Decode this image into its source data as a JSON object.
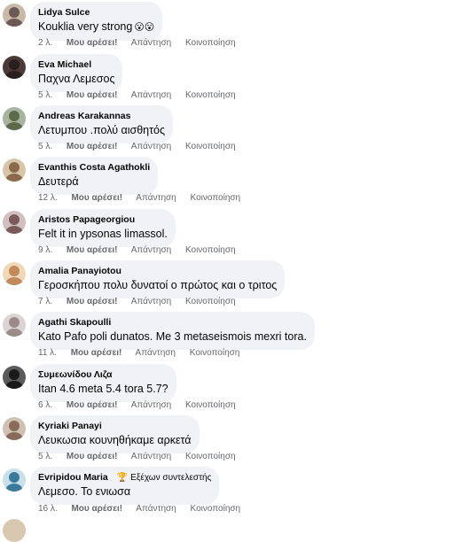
{
  "comments": [
    {
      "author": "Lidya Sulce",
      "text": "Kouklia very strong",
      "emoji": "😮😮",
      "time": "2 λ.",
      "avatar_color": "#6d5a55",
      "avatar_bg": "#c9b9a9"
    },
    {
      "author": "Eva Michael",
      "text": "Παχνα Λεμεσος",
      "emoji": "",
      "time": "5 λ.",
      "avatar_color": "#2a1f1f",
      "avatar_bg": "#4b3a38"
    },
    {
      "author": "Andreas Karakannas",
      "text": "Λετυμπου .πολύ αισθητός",
      "emoji": "",
      "time": "5 λ.",
      "avatar_color": "#5a6a4a",
      "avatar_bg": "#a8b4a0"
    },
    {
      "author": "Evanthis Costa Agathokli",
      "text": "Δευτερά",
      "emoji": "",
      "time": "12 λ.",
      "avatar_color": "#8a6a4a",
      "avatar_bg": "#d8c6a8"
    },
    {
      "author": "Aristos Papageorgiou",
      "text": "Felt it in ypsonas limassol.",
      "emoji": "",
      "time": "9 λ.",
      "avatar_color": "#7a5a5a",
      "avatar_bg": "#d2c0c0"
    },
    {
      "author": "Amalia Panayiotou",
      "text": "Γεροσκήπου πολυ δυνατοί ο πρώτος και ο τριτος",
      "emoji": "",
      "time": "7 λ.",
      "avatar_color": "#c08a5a",
      "avatar_bg": "#f0d8b8"
    },
    {
      "author": "Agathi Skapoulli",
      "text": "Kato Pafo poli dunatos. Me 3 metaseismois mexri tora.",
      "emoji": "",
      "time": "11 λ.",
      "avatar_color": "#9a8a8a",
      "avatar_bg": "#dcd4d4"
    },
    {
      "author": "Συμεωνίδου Λιζα",
      "text": "Itan 4.6 meta 5.4 tora 5.7?",
      "emoji": "",
      "time": "6 λ.",
      "avatar_color": "#1a1a1a",
      "avatar_bg": "#5a5a5a"
    },
    {
      "author": "Kyriaki Panayi",
      "text": "Λευκωσια κουνηθήκαμε αρκετά",
      "emoji": "",
      "time": "5 λ.",
      "avatar_color": "#8a6a5a",
      "avatar_bg": "#cfc0b0"
    },
    {
      "author": "Evripidou Maria",
      "badge": "Εξέχων συντελεστής",
      "text": "Λεμεσο. Το ενιωσα",
      "emoji": "",
      "time": "16 λ.",
      "avatar_color": "#3a7a9a",
      "avatar_bg": "#c8e0e8"
    }
  ],
  "actions": {
    "like": "Μου αρέσει!",
    "reply": "Απάντηση",
    "share": "Κοινοποίηση"
  },
  "badge_icon": "trophy-icon"
}
